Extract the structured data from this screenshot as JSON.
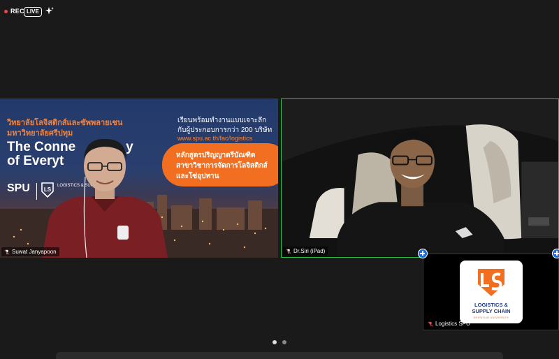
{
  "topbar": {
    "rec_label": "REC",
    "live_label": "LIVE",
    "sparkle_icon": "sparkle-icon"
  },
  "tiles": [
    {
      "name": "Suwat Janyapoon",
      "banner": {
        "thai_line1": "วิทยาลัยโลจิสติกส์และซัพพลายเชน",
        "thai_line2": "มหาวิทยาลัยศรีปทุม",
        "headline1": "The Conne",
        "headline1_suffix": "y",
        "headline2": "of Everyt",
        "spu": "SPU",
        "logistics_small": "LOGISTICS & SUPPLY",
        "right_line1": "เรียนพร้อมทำงานแบบเจาะลึก",
        "right_line2": "กับผู้ประกอบการกว่า 200 บริษัท",
        "right_url": "www.spu.ac.th/fac/logistics",
        "pill_line1": "หลักสูตรปริญญาตรีบัณฑิต",
        "pill_line2": "สาขาวิชาการจัดการโลจิสติกส์",
        "pill_line3": "และโซ่อุปทาน"
      }
    },
    {
      "name": "Dr.Siri (iPad)",
      "active_speaker": true
    },
    {
      "name": "Logistics SPU",
      "muted": true,
      "logo_line1": "LOGISTICS &",
      "logo_line2": "SUPPLY CHAIN",
      "logo_line3": "SRIPATUM UNIVERSITY"
    }
  ],
  "pagination": {
    "pages": 2,
    "current": 1
  },
  "colors": {
    "background": "#1a1a1a",
    "active_border": "#29c14a",
    "accent_orange": "#f26f21",
    "rec_red": "#e5484d",
    "plus_blue": "#1e6bd6"
  }
}
